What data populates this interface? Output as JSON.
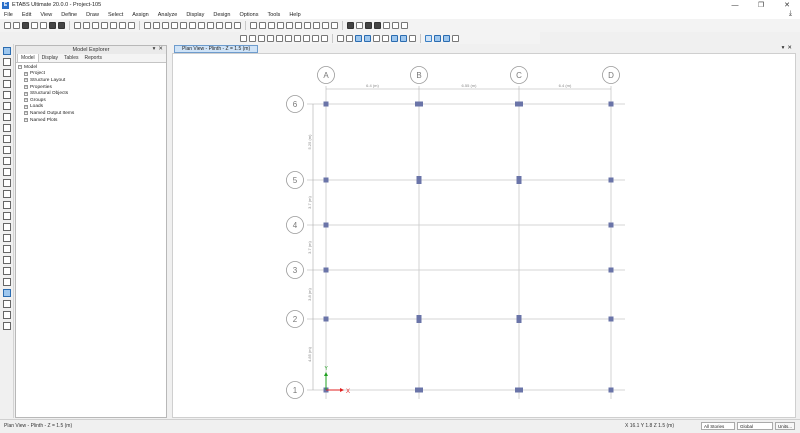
{
  "window": {
    "title": "ETABS Ultimate 20.0.0 - Project-105",
    "app_icon": "E",
    "controls": [
      "—",
      "❐",
      "✕"
    ]
  },
  "menu": {
    "items": [
      "File",
      "Edit",
      "View",
      "Define",
      "Draw",
      "Select",
      "Assign",
      "Analyze",
      "Display",
      "Design",
      "Options",
      "Tools",
      "Help"
    ]
  },
  "explorer": {
    "title": "Model Explorer",
    "tabs": [
      "Model",
      "Display",
      "Tables",
      "Reports"
    ],
    "selected_tab": 0,
    "tree_root": "Model",
    "tree_children": [
      "Project",
      "Structure Layout",
      "Properties",
      "Structural Objects",
      "Groups",
      "Loads",
      "Named Output Items",
      "Named Plots"
    ]
  },
  "view": {
    "tab_label": "Plan View - Plinth - Z = 1.5 (m)",
    "panel_buttons": [
      "▾",
      "✕"
    ]
  },
  "grid": {
    "x_labels": [
      "A",
      "B",
      "C",
      "D"
    ],
    "y_labels": [
      "6",
      "5",
      "4",
      "3",
      "2",
      "1"
    ],
    "x_spacings": [
      "6.4 (m)",
      "6.55 (m)",
      "6.4 (m)"
    ],
    "y_spacings": [
      "5.25 (m)",
      "3.7 (m)",
      "3.7 (m)",
      "3.8 (m)",
      "4.85 (m)"
    ],
    "axis_x": "X",
    "axis_y": "Y",
    "line_color": "#c8c8c8",
    "column_color": "#6a74a8",
    "axis_x_color": "#e02020",
    "axis_y_color": "#20a020"
  },
  "status": {
    "left": "Plan View - Plinth - Z = 1.5 (m)",
    "coords": "X 16.1  Y 1.8  Z 1.5 (m)",
    "story_select": "All Stories",
    "coord_select": "Global",
    "units_button": "Units..."
  }
}
